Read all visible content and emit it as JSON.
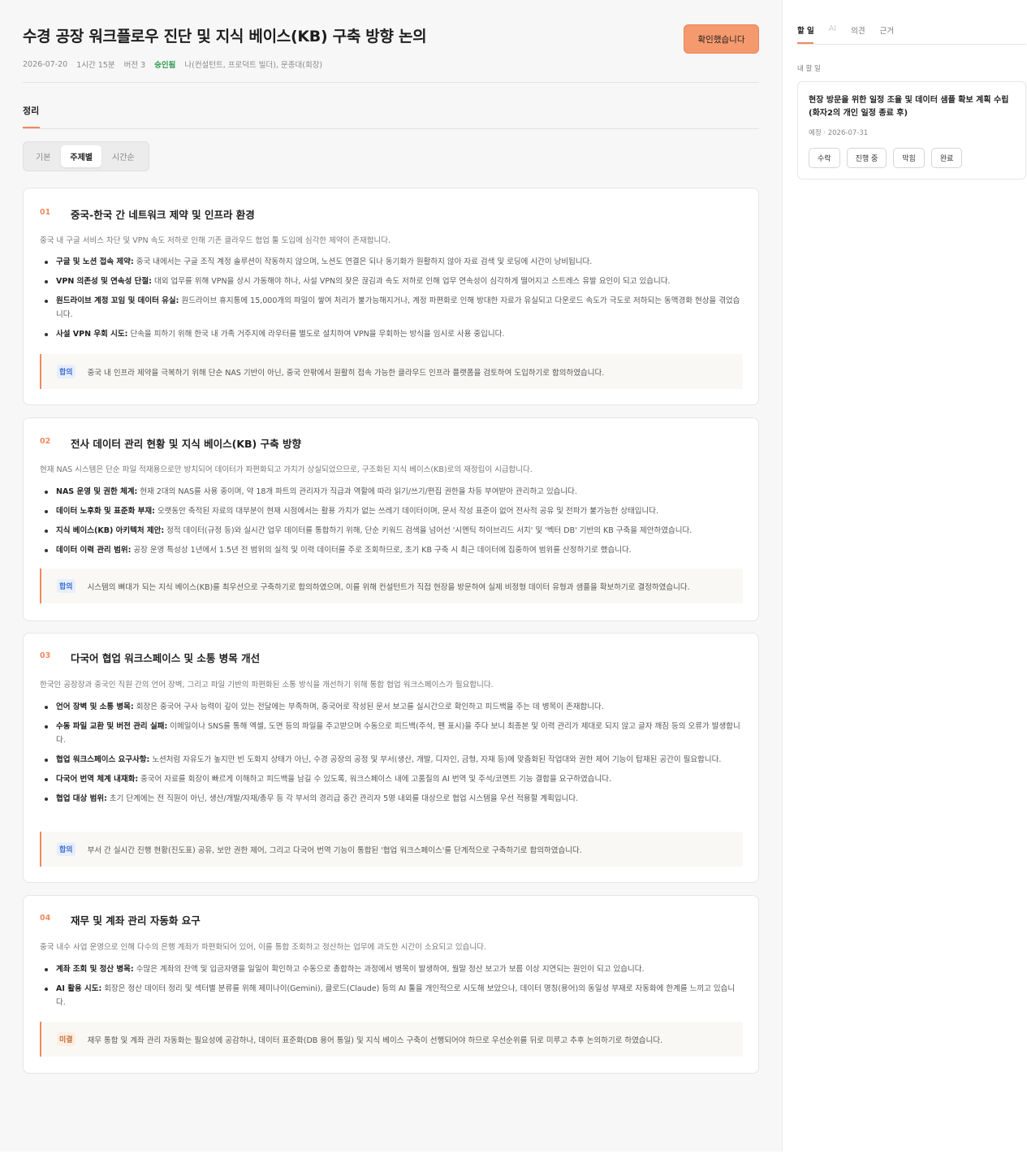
{
  "header": {
    "title": "수경 공장 워크플로우 진단 및 지식 베이스(KB) 구축 방향 논의",
    "date": "2026-07-20",
    "duration": "1시간 15분",
    "version": "버전 3",
    "status": "승인됨",
    "participants": "나(컨설턴트, 프로덕트 빌더), 문종대(회장)",
    "confirm_label": "확인했습니다"
  },
  "tabs": {
    "summary": "정리"
  },
  "view_modes": [
    "기본",
    "주제별",
    "시간순"
  ],
  "topics": [
    {
      "num": "01",
      "title": "중국-한국 간 네트워크 제약 및 인프라 환경",
      "desc": "중국 내 구글 서비스 차단 및 VPN 속도 저하로 인해 기존 클라우드 협업 툴 도입에 심각한 제약이 존재합니다.",
      "bullets": [
        {
          "label": "구글 및 노션 접속 제약:",
          "text": " 중국 내에서는 구글 조직 계정 솔루션이 작동하지 않으며, 노션도 연결은 되나 동기화가 원활하지 않아 자료 검색 및 로딩에 시간이 낭비됩니다."
        },
        {
          "label": "VPN 의존성 및 연속성 단절:",
          "text": " 대외 업무를 위해 VPN을 상시 가동해야 하나, 사설 VPN의 잦은 끊김과 속도 저하로 인해 업무 연속성이 심각하게 떨어지고 스트레스 유발 요인이 되고 있습니다."
        },
        {
          "label": "원드라이브 계정 꼬임 및 데이터 유실:",
          "text": " 원드라이브 휴지통에 15,000개의 파일이 쌓여 처리가 불가능해지거나, 계정 파편화로 인해 방대한 자료가 유실되고 다운로드 속도가 극도로 저하되는 동맥경화 현상을 겪었습니다."
        },
        {
          "label": "사설 VPN 우회 시도:",
          "text": " 단속을 피하기 위해 한국 내 가족 거주지에 라우터를 별도로 설치하여 VPN을 우회하는 방식을 임시로 사용 중입니다."
        }
      ],
      "badge": "합의",
      "note": "중국 내 인프라 제약을 극복하기 위해 단순 NAS 기반이 아닌, 중국 안팎에서 원활히 접속 가능한 클라우드 인프라 플랫폼을 검토하여 도입하기로 합의하였습니다."
    },
    {
      "num": "02",
      "title": "전사 데이터 관리 현황 및 지식 베이스(KB) 구축 방향",
      "desc": "현재 NAS 시스템은 단순 파일 적재용으로만 방치되어 데이터가 파편화되고 가치가 상실되었으므로, 구조화된 지식 베이스(KB)로의 재정립이 시급합니다.",
      "bullets": [
        {
          "label": "NAS 운영 및 권한 체계:",
          "text": " 현재 2대의 NAS를 사용 중이며, 약 18개 파트의 관리자가 직급과 역할에 따라 읽기/쓰기/편집 권한을 차등 부여받아 관리하고 있습니다."
        },
        {
          "label": "데이터 노후화 및 표준화 부재:",
          "text": " 오랫동안 축적된 자료의 대부분이 현재 시점에서는 활용 가치가 없는 쓰레기 데이터이며, 문서 작성 표준이 없어 전사적 공유 및 전파가 불가능한 상태입니다."
        },
        {
          "label": "지식 베이스(KB) 아키텍처 제안:",
          "text": " 정적 데이터(규정 등)와 실시간 업무 데이터를 통합하기 위해, 단순 키워드 검색을 넘어선 '시멘틱 하이브리드 서치' 및 '벡터 DB' 기반의 KB 구축을 제안하였습니다."
        },
        {
          "label": "데이터 이력 관리 범위:",
          "text": " 공장 운영 특성상 1년에서 1.5년 전 범위의 실적 및 이력 데이터를 주로 조회하므로, 초기 KB 구축 시 최근 데이터에 집중하여 범위를 산정하기로 했습니다."
        }
      ],
      "badge": "합의",
      "note": "시스템의 뼈대가 되는 지식 베이스(KB)를 최우선으로 구축하기로 합의하였으며, 이를 위해 컨설턴트가 직접 현장을 방문하여 실제 비정형 데이터 유형과 샘플을 확보하기로 결정하였습니다."
    },
    {
      "num": "03",
      "title": "다국어 협업 워크스페이스 및 소통 병목 개선",
      "desc": "한국인 공장장과 중국인 직원 간의 언어 장벽, 그리고 파일 기반의 파편화된 소통 방식을 개선하기 위해 통합 협업 워크스페이스가 필요합니다.",
      "bullets": [
        {
          "label": "언어 장벽 및 소통 병목:",
          "text": " 회장은 중국어 구사 능력이 깊이 있는 전달에는 부족하며, 중국어로 작성된 문서 보고를 실시간으로 확인하고 피드백을 주는 데 병목이 존재합니다."
        },
        {
          "label": "수동 파일 교환 및 버전 관리 실패:",
          "text": " 이메일이나 SNS를 통해 엑셀, 도면 등의 파일을 주고받으며 수동으로 피드백(주석, 펜 표시)을 주다 보니 최종본 및 이력 관리가 제대로 되지 않고 글자 깨짐 등의 오류가 발생합니다."
        },
        {
          "label": "협업 워크스페이스 요구사항:",
          "text": " 노션처럼 자유도가 높지만 빈 도화지 상태가 아닌, 수경 공장의 공정 및 부서(생산, 개발, 디자인, 금형, 자재 등)에 맞춤화된 작업대와 권한 제어 기능이 탑재된 공간이 필요합니다."
        },
        {
          "label": "다국어 번역 체계 내재화:",
          "text": " 중국어 자료를 회장이 빠르게 이해하고 피드백을 남길 수 있도록, 워크스페이스 내에 고품질의 AI 번역 및 주석/코멘트 기능 결합을 요구하였습니다."
        },
        {
          "label": "협업 대상 범위:",
          "text": " 초기 단계에는 전 직원이 아닌, 생산/개발/자재/총무 등 각 부서의 경리급 중간 관리자 5명 내외를 대상으로 협업 시스템을 우선 적용할 계획입니다."
        }
      ],
      "badge": "합의",
      "note": "부서 간 실시간 진행 현황(진도표) 공유, 보안 권한 제어, 그리고 다국어 번역 기능이 통합된 '협업 워크스페이스'를 단계적으로 구축하기로 합의하였습니다."
    },
    {
      "num": "04",
      "title": "재무 및 계좌 관리 자동화 요구",
      "desc": "중국 내수 사업 운영으로 인해 다수의 은행 계좌가 파편화되어 있어, 이를 통합 조회하고 정산하는 업무에 과도한 시간이 소요되고 있습니다.",
      "bullets": [
        {
          "label": "계좌 조회 및 정산 병목:",
          "text": " 수많은 계좌의 잔액 및 입금자명을 일일이 확인하고 수동으로 총합하는 과정에서 병목이 발생하여, 월말 정산 보고가 보름 이상 지연되는 원인이 되고 있습니다."
        },
        {
          "label": "AI 활용 시도:",
          "text": " 회장은 정산 데이터 정리 및 섹터별 분류를 위해 제미나이(Gemini), 클로드(Claude) 등의 AI 툴을 개인적으로 시도해 보았으나, 데이터 명칭(용어)의 동일성 부재로 자동화에 한계를 느끼고 있습니다."
        }
      ],
      "badge": "미결",
      "note": "재무 통합 및 계좌 관리 자동화는 필요성에 공감하나, 데이터 표준화(DB 용어 통일) 및 지식 베이스 구축이 선행되어야 하므로 우선순위를 뒤로 미루고 추후 논의하기로 하였습니다."
    }
  ],
  "sidebar": {
    "tabs": [
      "할 일",
      "AI",
      "의견",
      "근거"
    ],
    "section_label": "내 할 일",
    "todo": {
      "title": "현장 방문을 위한 일정 조율 및 데이터 샘플 확보 계획 수립 (화자2의 개인 일정 종료 후)",
      "meta": "예정 · 2026-07-31",
      "actions": [
        "수락",
        "진행 중",
        "막힘",
        "완료"
      ]
    }
  }
}
